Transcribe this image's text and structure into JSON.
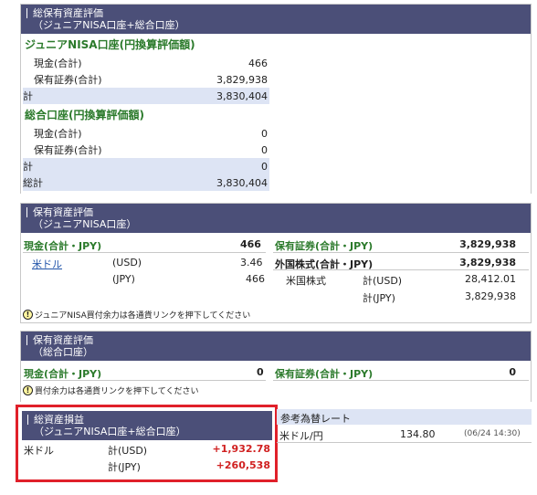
{
  "top": {
    "header_line1": "総保有資産評価",
    "header_line2": "（ジュニアNISA口座+総合口座）",
    "junior": {
      "title": "ジュニアNISA口座(円換算評価額)",
      "rows": [
        {
          "label": "現金(合計)",
          "value": "466"
        },
        {
          "label": "保有証券(合計)",
          "value": "3,829,938"
        }
      ],
      "total_label": "計",
      "total_value": "3,830,404"
    },
    "general": {
      "title": "総合口座(円換算評価額)",
      "rows": [
        {
          "label": "現金(合計)",
          "value": "0"
        },
        {
          "label": "保有証券(合計)",
          "value": "0"
        }
      ],
      "total_label": "計",
      "total_value": "0"
    },
    "grand_label": "総計",
    "grand_value": "3,830,404"
  },
  "junior_holdings": {
    "header_line1": "保有資産評価",
    "header_line2": "（ジュニアNISA口座）",
    "cash_title": "現金(合計・JPY)",
    "cash_total": "466",
    "securities_title": "保有証券(合計・JPY)",
    "securities_total": "3,829,938",
    "usd_link": "米ドル",
    "usd_label": "(USD)",
    "usd_value": "3.46",
    "jpy_label": "(JPY)",
    "jpy_value": "466",
    "foreign_title": "外国株式(合計・JPY)",
    "foreign_total": "3,829,938",
    "us_stock": "米国株式",
    "us_usd_label": "計(USD)",
    "us_usd_value": "28,412.01",
    "us_jpy_label": "計(JPY)",
    "us_jpy_value": "3,829,938",
    "note": "ジュニアNISA買付余力は各通貨リンクを押下してください"
  },
  "general_holdings": {
    "header_line1": "保有資産評価",
    "header_line2": "（総合口座）",
    "cash_title": "現金(合計・JPY)",
    "cash_total": "0",
    "securities_title": "保有証券(合計・JPY)",
    "securities_total": "0",
    "note": "買付余力は各通貨リンクを押下してください"
  },
  "pnl": {
    "header_line1": "総資産損益",
    "header_line2": "（ジュニアNISA口座+総合口座）",
    "currency": "米ドル",
    "usd_label": "計(USD)",
    "usd_value": "+1,932.78",
    "jpy_label": "計(JPY)",
    "jpy_value": "+260,538"
  },
  "fx": {
    "title": "参考為替レート",
    "pair": "米ドル/円",
    "rate": "134.80",
    "time": "(06/24 14:30)"
  }
}
